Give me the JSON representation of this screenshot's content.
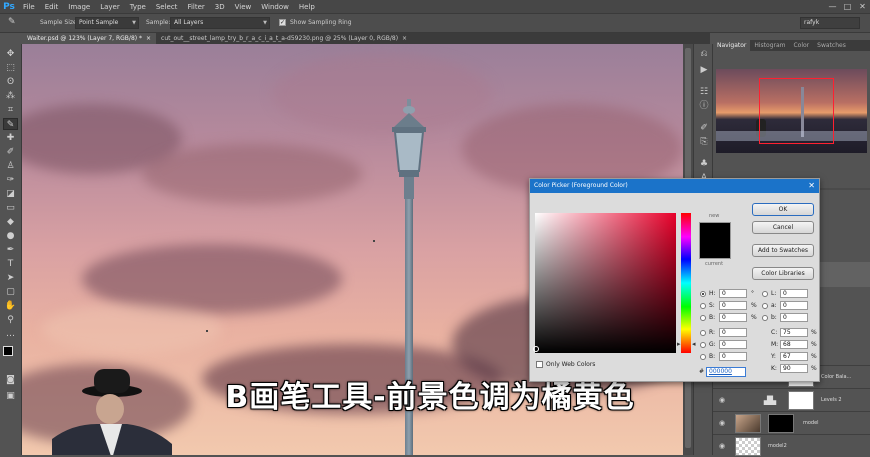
{
  "app": {
    "logo": "Ps"
  },
  "menu": [
    "File",
    "Edit",
    "Image",
    "Layer",
    "Type",
    "Select",
    "Filter",
    "3D",
    "View",
    "Window",
    "Help"
  ],
  "window_controls": {
    "minimize": "—",
    "maximize": "□",
    "close": "✕"
  },
  "options_bar": {
    "sample_size_label": "Sample Size:",
    "sample_size_value": "Point Sample",
    "sample_label": "Sample:",
    "sample_value": "All Layers",
    "show_ring_label": "Show Sampling Ring",
    "workspace_value": "rafyk"
  },
  "tabs": [
    {
      "label": "Waiter.psd @ 123% (Layer 7, RGB/8) *",
      "close": "×"
    },
    {
      "label": "cut_out__street_lamp_try_b_r_a_c_i_a_t_a-d59230.png @ 25% (Layer 0, RGB/8)",
      "close": "×"
    }
  ],
  "panel_tabs": [
    "Navigator",
    "Histogram",
    "Color",
    "Swatches"
  ],
  "subtitle": "B画笔工具-前景色调为橘黄色",
  "color_picker": {
    "title": "Color Picker (Foreground Color)",
    "close": "✕",
    "new_label": "new",
    "current_label": "current",
    "current_color": "#000000",
    "buttons": {
      "ok": "OK",
      "cancel": "Cancel",
      "add_swatches": "Add to Swatches",
      "libraries": "Color Libraries"
    },
    "fields": {
      "H": {
        "label": "H:",
        "value": "0",
        "unit": "°"
      },
      "S": {
        "label": "S:",
        "value": "0",
        "unit": "%"
      },
      "B": {
        "label": "B:",
        "value": "0",
        "unit": "%"
      },
      "R": {
        "label": "R:",
        "value": "0"
      },
      "G": {
        "label": "G:",
        "value": "0"
      },
      "Bl": {
        "label": "B:",
        "value": "0"
      },
      "L": {
        "label": "L:",
        "value": "0"
      },
      "a": {
        "label": "a:",
        "value": "0"
      },
      "b": {
        "label": "b:",
        "value": "0"
      },
      "C": {
        "label": "C:",
        "value": "75",
        "unit": "%"
      },
      "M": {
        "label": "M:",
        "value": "68",
        "unit": "%"
      },
      "Y": {
        "label": "Y:",
        "value": "67",
        "unit": "%"
      },
      "K": {
        "label": "K:",
        "value": "90",
        "unit": "%"
      }
    },
    "web_colors_label": "Only Web Colors",
    "hex_label": "#",
    "hex_value": "000000"
  },
  "layers": [
    {
      "name": "Color Bala..."
    },
    {
      "name": "Levels 2"
    },
    {
      "name": "model"
    },
    {
      "name": "model2"
    }
  ]
}
